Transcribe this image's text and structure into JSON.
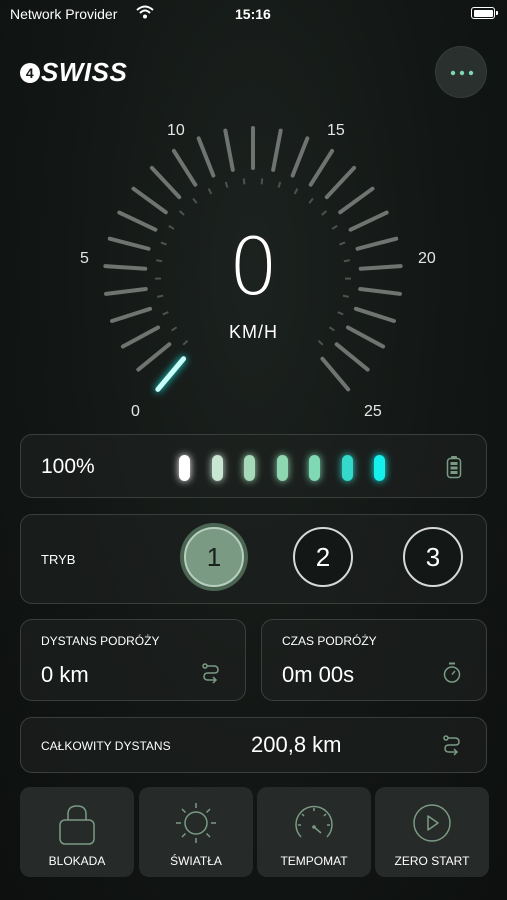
{
  "status_bar": {
    "carrier": "Network Provider",
    "time": "15:16"
  },
  "logo": {
    "four": "4",
    "text": "SWISS"
  },
  "speedometer": {
    "speed": "0",
    "unit": "KM/H",
    "scale_labels": [
      "0",
      "5",
      "10",
      "15",
      "20",
      "25"
    ],
    "max_speed": 25,
    "current_speed": 0
  },
  "battery": {
    "percent": "100%",
    "segment_count": 7,
    "segment_colors": [
      "#ffffff",
      "#c9e6d2",
      "#a6d9b7",
      "#8fd7b0",
      "#7fd9b5",
      "#34d9cc",
      "#16f0ec"
    ]
  },
  "mode": {
    "label": "TRYB",
    "options": [
      "1",
      "2",
      "3"
    ],
    "selected": "1"
  },
  "trip_distance": {
    "label": "DYSTANS PODRÓŻY",
    "value": "0 km",
    "icon": "route-icon"
  },
  "trip_time": {
    "label": "CZAS PODRÓŻY",
    "value": "0m 00s",
    "icon": "stopwatch-icon"
  },
  "total_distance": {
    "label": "CAŁKOWITY DYSTANS",
    "value": "200,8 km",
    "icon": "route-icon"
  },
  "actions": [
    {
      "label": "BLOKADA",
      "icon": "lock-icon"
    },
    {
      "label": "ŚWIATŁA",
      "icon": "sun-icon"
    },
    {
      "label": "TEMPOMAT",
      "icon": "speedometer-icon"
    },
    {
      "label": "ZERO START",
      "icon": "play-icon"
    }
  ],
  "colors": {
    "accent_green": "#7a9a84",
    "accent_cyan": "#16f0ec",
    "card_border": "#3a3f3c"
  }
}
